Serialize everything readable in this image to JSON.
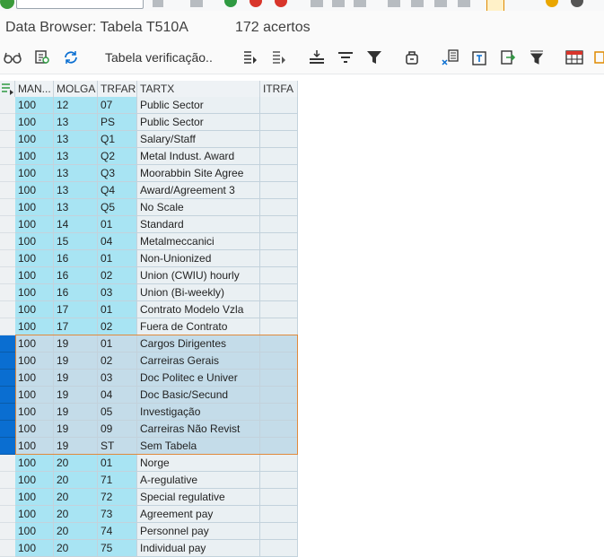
{
  "window": {
    "title": "Data Browser: Tabela T510A",
    "hits": "172 acertos"
  },
  "toolbar": {
    "check_table_label": "Tabela verificação.."
  },
  "grid": {
    "columns": [
      "MAN...",
      "MOLGA",
      "TRFAR",
      "TARTX",
      "ITRFA"
    ],
    "rows": [
      {
        "mandt": "100",
        "molga": "12",
        "trfar": "07",
        "tartx": "Public Sector",
        "itrfa": "",
        "selected": false
      },
      {
        "mandt": "100",
        "molga": "13",
        "trfar": "PS",
        "tartx": "Public Sector",
        "itrfa": "",
        "selected": false
      },
      {
        "mandt": "100",
        "molga": "13",
        "trfar": "Q1",
        "tartx": "Salary/Staff",
        "itrfa": "",
        "selected": false
      },
      {
        "mandt": "100",
        "molga": "13",
        "trfar": "Q2",
        "tartx": "Metal Indust. Award",
        "itrfa": "",
        "selected": false
      },
      {
        "mandt": "100",
        "molga": "13",
        "trfar": "Q3",
        "tartx": "Moorabbin Site Agree",
        "itrfa": "",
        "selected": false
      },
      {
        "mandt": "100",
        "molga": "13",
        "trfar": "Q4",
        "tartx": "Award/Agreement 3",
        "itrfa": "",
        "selected": false
      },
      {
        "mandt": "100",
        "molga": "13",
        "trfar": "Q5",
        "tartx": "No Scale",
        "itrfa": "",
        "selected": false
      },
      {
        "mandt": "100",
        "molga": "14",
        "trfar": "01",
        "tartx": "Standard",
        "itrfa": "",
        "selected": false
      },
      {
        "mandt": "100",
        "molga": "15",
        "trfar": "04",
        "tartx": "Metalmeccanici",
        "itrfa": "",
        "selected": false
      },
      {
        "mandt": "100",
        "molga": "16",
        "trfar": "01",
        "tartx": "Non-Unionized",
        "itrfa": "",
        "selected": false
      },
      {
        "mandt": "100",
        "molga": "16",
        "trfar": "02",
        "tartx": "Union (CWIU) hourly",
        "itrfa": "",
        "selected": false
      },
      {
        "mandt": "100",
        "molga": "16",
        "trfar": "03",
        "tartx": "Union (Bi-weekly)",
        "itrfa": "",
        "selected": false
      },
      {
        "mandt": "100",
        "molga": "17",
        "trfar": "01",
        "tartx": "Contrato Modelo Vzla",
        "itrfa": "",
        "selected": false
      },
      {
        "mandt": "100",
        "molga": "17",
        "trfar": "02",
        "tartx": "Fuera de Contrato",
        "itrfa": "",
        "selected": false
      },
      {
        "mandt": "100",
        "molga": "19",
        "trfar": "01",
        "tartx": "Cargos Dirigentes",
        "itrfa": "",
        "selected": true
      },
      {
        "mandt": "100",
        "molga": "19",
        "trfar": "02",
        "tartx": "Carreiras Gerais",
        "itrfa": "",
        "selected": true
      },
      {
        "mandt": "100",
        "molga": "19",
        "trfar": "03",
        "tartx": "Doc Politec e Univer",
        "itrfa": "",
        "selected": true
      },
      {
        "mandt": "100",
        "molga": "19",
        "trfar": "04",
        "tartx": "Doc Basic/Secund",
        "itrfa": "",
        "selected": true
      },
      {
        "mandt": "100",
        "molga": "19",
        "trfar": "05",
        "tartx": "Investigação",
        "itrfa": "",
        "selected": true
      },
      {
        "mandt": "100",
        "molga": "19",
        "trfar": "09",
        "tartx": "Carreiras Não Revist",
        "itrfa": "",
        "selected": true
      },
      {
        "mandt": "100",
        "molga": "19",
        "trfar": "ST",
        "tartx": "Sem Tabela",
        "itrfa": "",
        "selected": true
      },
      {
        "mandt": "100",
        "molga": "20",
        "trfar": "01",
        "tartx": "Norge",
        "itrfa": "",
        "selected": false
      },
      {
        "mandt": "100",
        "molga": "20",
        "trfar": "71",
        "tartx": "A-regulative",
        "itrfa": "",
        "selected": false
      },
      {
        "mandt": "100",
        "molga": "20",
        "trfar": "72",
        "tartx": "Special regulative",
        "itrfa": "",
        "selected": false
      },
      {
        "mandt": "100",
        "molga": "20",
        "trfar": "73",
        "tartx": "Agreement pay",
        "itrfa": "",
        "selected": false
      },
      {
        "mandt": "100",
        "molga": "20",
        "trfar": "74",
        "tartx": "Personnel pay",
        "itrfa": "",
        "selected": false
      },
      {
        "mandt": "100",
        "molga": "20",
        "trfar": "75",
        "tartx": "Individual pay",
        "itrfa": "",
        "selected": false
      }
    ]
  }
}
